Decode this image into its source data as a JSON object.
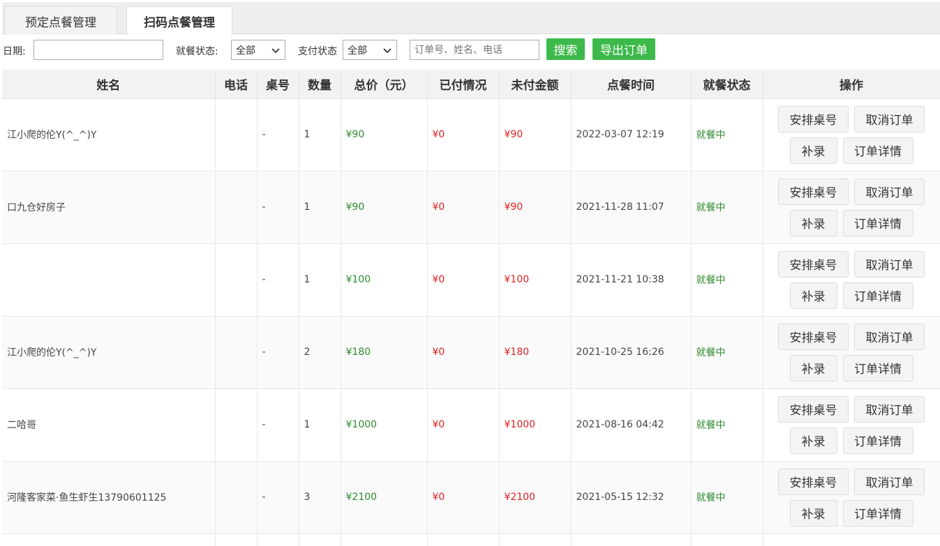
{
  "tabs": [
    {
      "label": "预定点餐管理",
      "active": false
    },
    {
      "label": "扫码点餐管理",
      "active": true
    }
  ],
  "filters": {
    "date_label": "日期:",
    "date_value": "",
    "dining_label": "就餐状态:",
    "dining_selected": "全部",
    "pay_label": "支付状态",
    "pay_selected": "全部",
    "search_placeholder": "订单号、姓名、电话",
    "search_button": "搜索",
    "export_button": "导出订单"
  },
  "table": {
    "headers": [
      "姓名",
      "电话",
      "桌号",
      "数量",
      "总价（元）",
      "已付情况",
      "未付金额",
      "点餐时间",
      "就餐状态",
      "操作"
    ],
    "actions": [
      "安排桌号",
      "取消订单",
      "补录",
      "订单详情"
    ],
    "rows": [
      {
        "name": "江小爬的伦Y(^_^)Y",
        "phone": "",
        "table": "-",
        "qty": "1",
        "total": "¥90",
        "paid": "¥0",
        "unpaid": "¥90",
        "time": "2022-03-07 12:19",
        "status": "就餐中"
      },
      {
        "name": "口九仓好房子",
        "phone": "",
        "table": "-",
        "qty": "1",
        "total": "¥90",
        "paid": "¥0",
        "unpaid": "¥90",
        "time": "2021-11-28 11:07",
        "status": "就餐中"
      },
      {
        "name": "",
        "phone": "",
        "table": "-",
        "qty": "1",
        "total": "¥100",
        "paid": "¥0",
        "unpaid": "¥100",
        "time": "2021-11-21 10:38",
        "status": "就餐中"
      },
      {
        "name": "江小爬的伦Y(^_^)Y",
        "phone": "",
        "table": "-",
        "qty": "2",
        "total": "¥180",
        "paid": "¥0",
        "unpaid": "¥180",
        "time": "2021-10-25 16:26",
        "status": "就餐中"
      },
      {
        "name": "二哈哥",
        "phone": "",
        "table": "-",
        "qty": "1",
        "total": "¥1000",
        "paid": "¥0",
        "unpaid": "¥1000",
        "time": "2021-08-16 04:42",
        "status": "就餐中"
      },
      {
        "name": "河隆客家菜·鱼生虾生13790601125",
        "phone": "",
        "table": "-",
        "qty": "3",
        "total": "¥2100",
        "paid": "¥0",
        "unpaid": "¥2100",
        "time": "2021-05-15 12:32",
        "status": "就餐中"
      }
    ]
  }
}
